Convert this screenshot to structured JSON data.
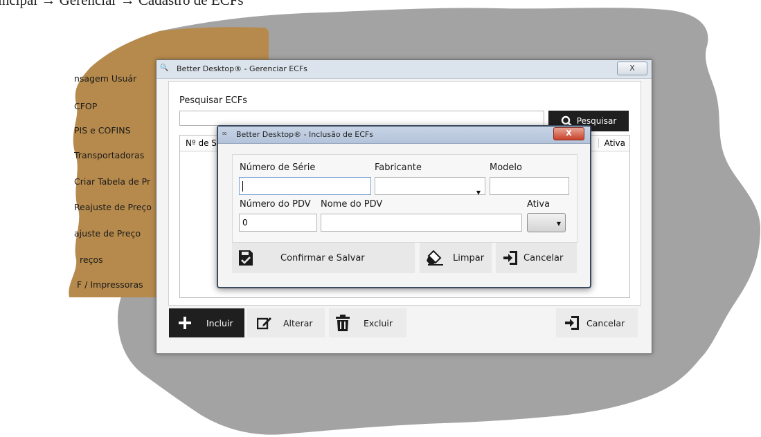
{
  "breadcrumb": "rincipal → Gerenciar → Cadastro de ECFs",
  "sidebar": {
    "items": [
      {
        "label": "nsagem Usuár"
      },
      {
        "label": "CFOP"
      },
      {
        "label": "PIS e COFINS"
      },
      {
        "label": "Transportadoras"
      },
      {
        "label": "Criar Tabela de Pr"
      },
      {
        "label": "Reajuste de Preço"
      },
      {
        "label": "ajuste de Preço"
      },
      {
        "label": "reços"
      },
      {
        "label": "F / Impressoras"
      }
    ]
  },
  "main_window": {
    "title": "Better Desktop® - Gerenciar ECFs",
    "close_label": "X",
    "search_label": "Pesquisar ECFs",
    "search_value": "",
    "search_button": "Pesquisar",
    "grid": {
      "col_first": "Nº de S",
      "col_last": "Ativa"
    },
    "buttons": {
      "incluir": "Incluir",
      "alterar": "Alterar",
      "excluir": "Excluir",
      "cancelar": "Cancelar"
    }
  },
  "dialog": {
    "title": "Better Desktop® - Inclusão de ECFs",
    "close_label": "X",
    "fields": {
      "numero_serie": {
        "label": "Número de Série",
        "value": ""
      },
      "fabricante": {
        "label": "Fabricante",
        "value": ""
      },
      "modelo": {
        "label": "Modelo",
        "value": ""
      },
      "numero_pdv": {
        "label": "Número do PDV",
        "value": "0"
      },
      "nome_pdv": {
        "label": "Nome do PDV",
        "value": ""
      },
      "ativa": {
        "label": "Ativa",
        "value": ""
      }
    },
    "buttons": {
      "confirmar": "Confirmar e Salvar",
      "limpar": "Limpar",
      "cancelar": "Cancelar"
    }
  },
  "colors": {
    "sidebar_bg": "#b68a4c",
    "backdrop_gray": "#a3a3a3",
    "dark_button": "#1f1f1f",
    "dialog_border": "#3b4a60"
  }
}
